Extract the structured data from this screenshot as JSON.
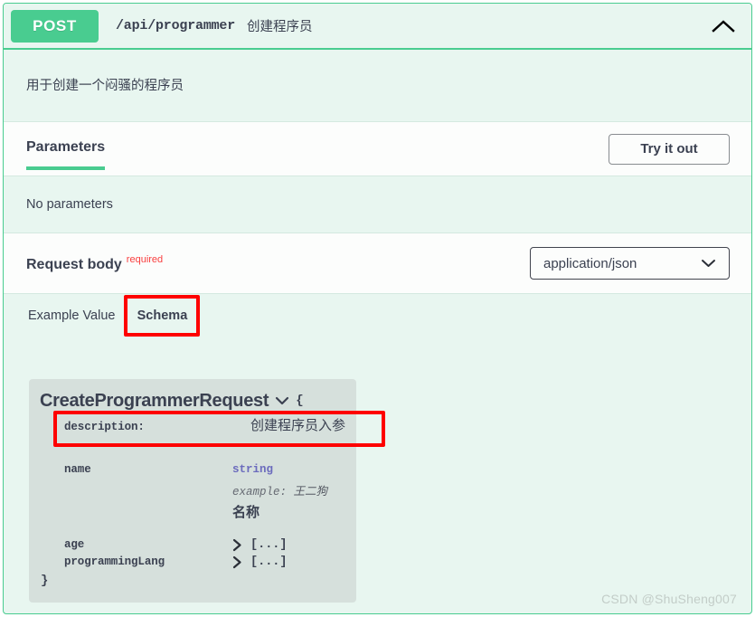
{
  "operation": {
    "method": "POST",
    "path": "/api/programmer",
    "summary": "创建程序员",
    "description": "用于创建一个闷骚的程序员",
    "collapse_icon": "chevron-up-icon"
  },
  "tabs": {
    "parameters_label": "Parameters",
    "try_it_out_label": "Try it out",
    "no_parameters_text": "No parameters"
  },
  "request_body": {
    "title": "Request body",
    "required_label": "required",
    "content_type": "application/json",
    "caret_icon": "chevron-down-icon"
  },
  "body_tabs": {
    "example_value_label": "Example Value",
    "schema_label": "Schema"
  },
  "model": {
    "name": "CreateProgrammerRequest",
    "toggle_icon": "chevron-down-icon",
    "open_brace": "{",
    "close_brace": "}",
    "rows": [
      {
        "key": "description:",
        "value_cn": "创建程序员入参"
      },
      {
        "key": "name",
        "type": "string",
        "example_label": "example:",
        "example_value": "王二狗",
        "title_cn": "名称"
      },
      {
        "key": "age",
        "collapsed": "[...]",
        "chevron": "chevron-right-icon"
      },
      {
        "key": "programmingLang",
        "collapsed": "[...]",
        "chevron": "chevron-right-icon"
      }
    ]
  },
  "annotations": {
    "schema_highlight_color": "#fe0000",
    "description_highlight_color": "#fe0000"
  },
  "watermark": "CSDN @ShuSheng007",
  "colors": {
    "method_green": "#49cc90",
    "panel_green": "#e8f6f0",
    "required_red": "#f93e3e",
    "model_gray": "#d6e0dc",
    "type_purple": "#6b6bbd"
  }
}
